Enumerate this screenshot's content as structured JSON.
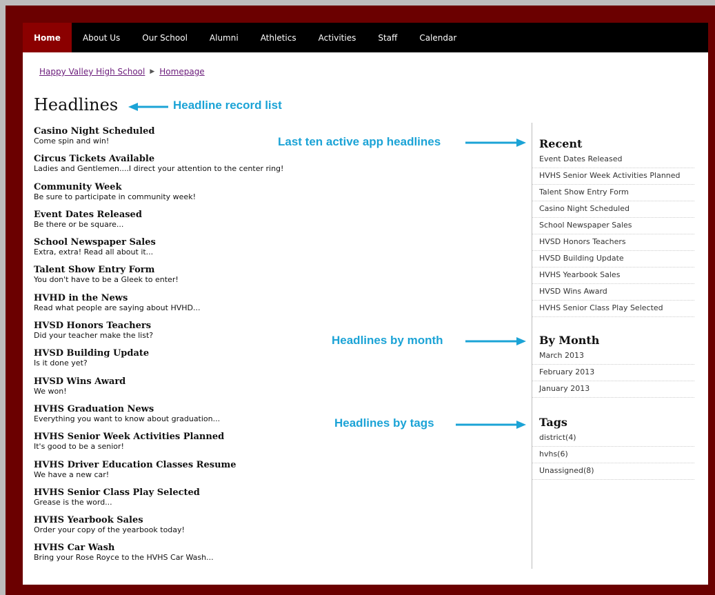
{
  "nav": {
    "items": [
      {
        "label": "Home"
      },
      {
        "label": "About Us"
      },
      {
        "label": "Our School"
      },
      {
        "label": "Alumni"
      },
      {
        "label": "Athletics"
      },
      {
        "label": "Activities"
      },
      {
        "label": "Staff"
      },
      {
        "label": "Calendar"
      }
    ],
    "active": "Home"
  },
  "breadcrumb": {
    "items": [
      "Happy Valley High School",
      "Homepage"
    ]
  },
  "page_title": "Headlines",
  "headlines": [
    {
      "title": "Casino Night Scheduled",
      "summary": "Come spin and win!"
    },
    {
      "title": "Circus Tickets Available",
      "summary": "Ladies and Gentlemen....I direct your attention to the center ring!"
    },
    {
      "title": "Community Week",
      "summary": "Be sure to participate in community week!"
    },
    {
      "title": "Event Dates Released",
      "summary": "Be there or be square..."
    },
    {
      "title": "School Newspaper Sales",
      "summary": "Extra, extra! Read all about it..."
    },
    {
      "title": "Talent Show Entry Form",
      "summary": "You don't have to be a Gleek to enter!"
    },
    {
      "title": "HVHD in the News",
      "summary": "Read what people are saying about HVHD..."
    },
    {
      "title": "HVSD Honors Teachers",
      "summary": "Did your teacher make the list?"
    },
    {
      "title": "HVSD Building Update",
      "summary": "Is it done yet?"
    },
    {
      "title": "HVSD Wins Award",
      "summary": "We won!"
    },
    {
      "title": "HVHS Graduation News",
      "summary": "Everything you want to know about graduation..."
    },
    {
      "title": "HVHS Senior Week Activities Planned",
      "summary": "It's good to be a senior!"
    },
    {
      "title": "HVHS Driver Education Classes Resume",
      "summary": "We have a new car!"
    },
    {
      "title": "HVHS Senior Class Play Selected",
      "summary": "Grease is the word..."
    },
    {
      "title": "HVHS Yearbook Sales",
      "summary": "Order your copy of the yearbook today!"
    },
    {
      "title": "HVHS Car Wash",
      "summary": "Bring your Rose Royce to the HVHS Car Wash..."
    }
  ],
  "sidebar": {
    "recent": {
      "heading": "Recent",
      "items": [
        "Event Dates Released",
        "HVHS Senior Week Activities Planned",
        "Talent Show Entry Form",
        "Casino Night Scheduled",
        "School Newspaper Sales",
        "HVSD Honors Teachers",
        "HVSD Building Update",
        "HVHS Yearbook Sales",
        "HVSD Wins Award",
        "HVHS Senior Class Play Selected"
      ]
    },
    "by_month": {
      "heading": "By Month",
      "items": [
        "March 2013",
        "February 2013",
        "January 2013"
      ]
    },
    "tags": {
      "heading": "Tags",
      "items": [
        "district(4)",
        "hvhs(6)",
        "Unassigned(8)"
      ]
    }
  },
  "annotations": {
    "headline_record_list": "Headline record list",
    "last_ten": "Last ten active app headlines",
    "by_month": "Headlines by month",
    "by_tags": "Headlines by tags"
  },
  "colors": {
    "frame": "#6b0000",
    "nav_bg": "#000000",
    "nav_active": "#8b0000",
    "link": "#6a1b7a",
    "annotation": "#1ba3d6"
  },
  "icons": {
    "breadcrumb_separator": "triangle-right-icon",
    "annotation_arrow": "arrow-icon"
  }
}
